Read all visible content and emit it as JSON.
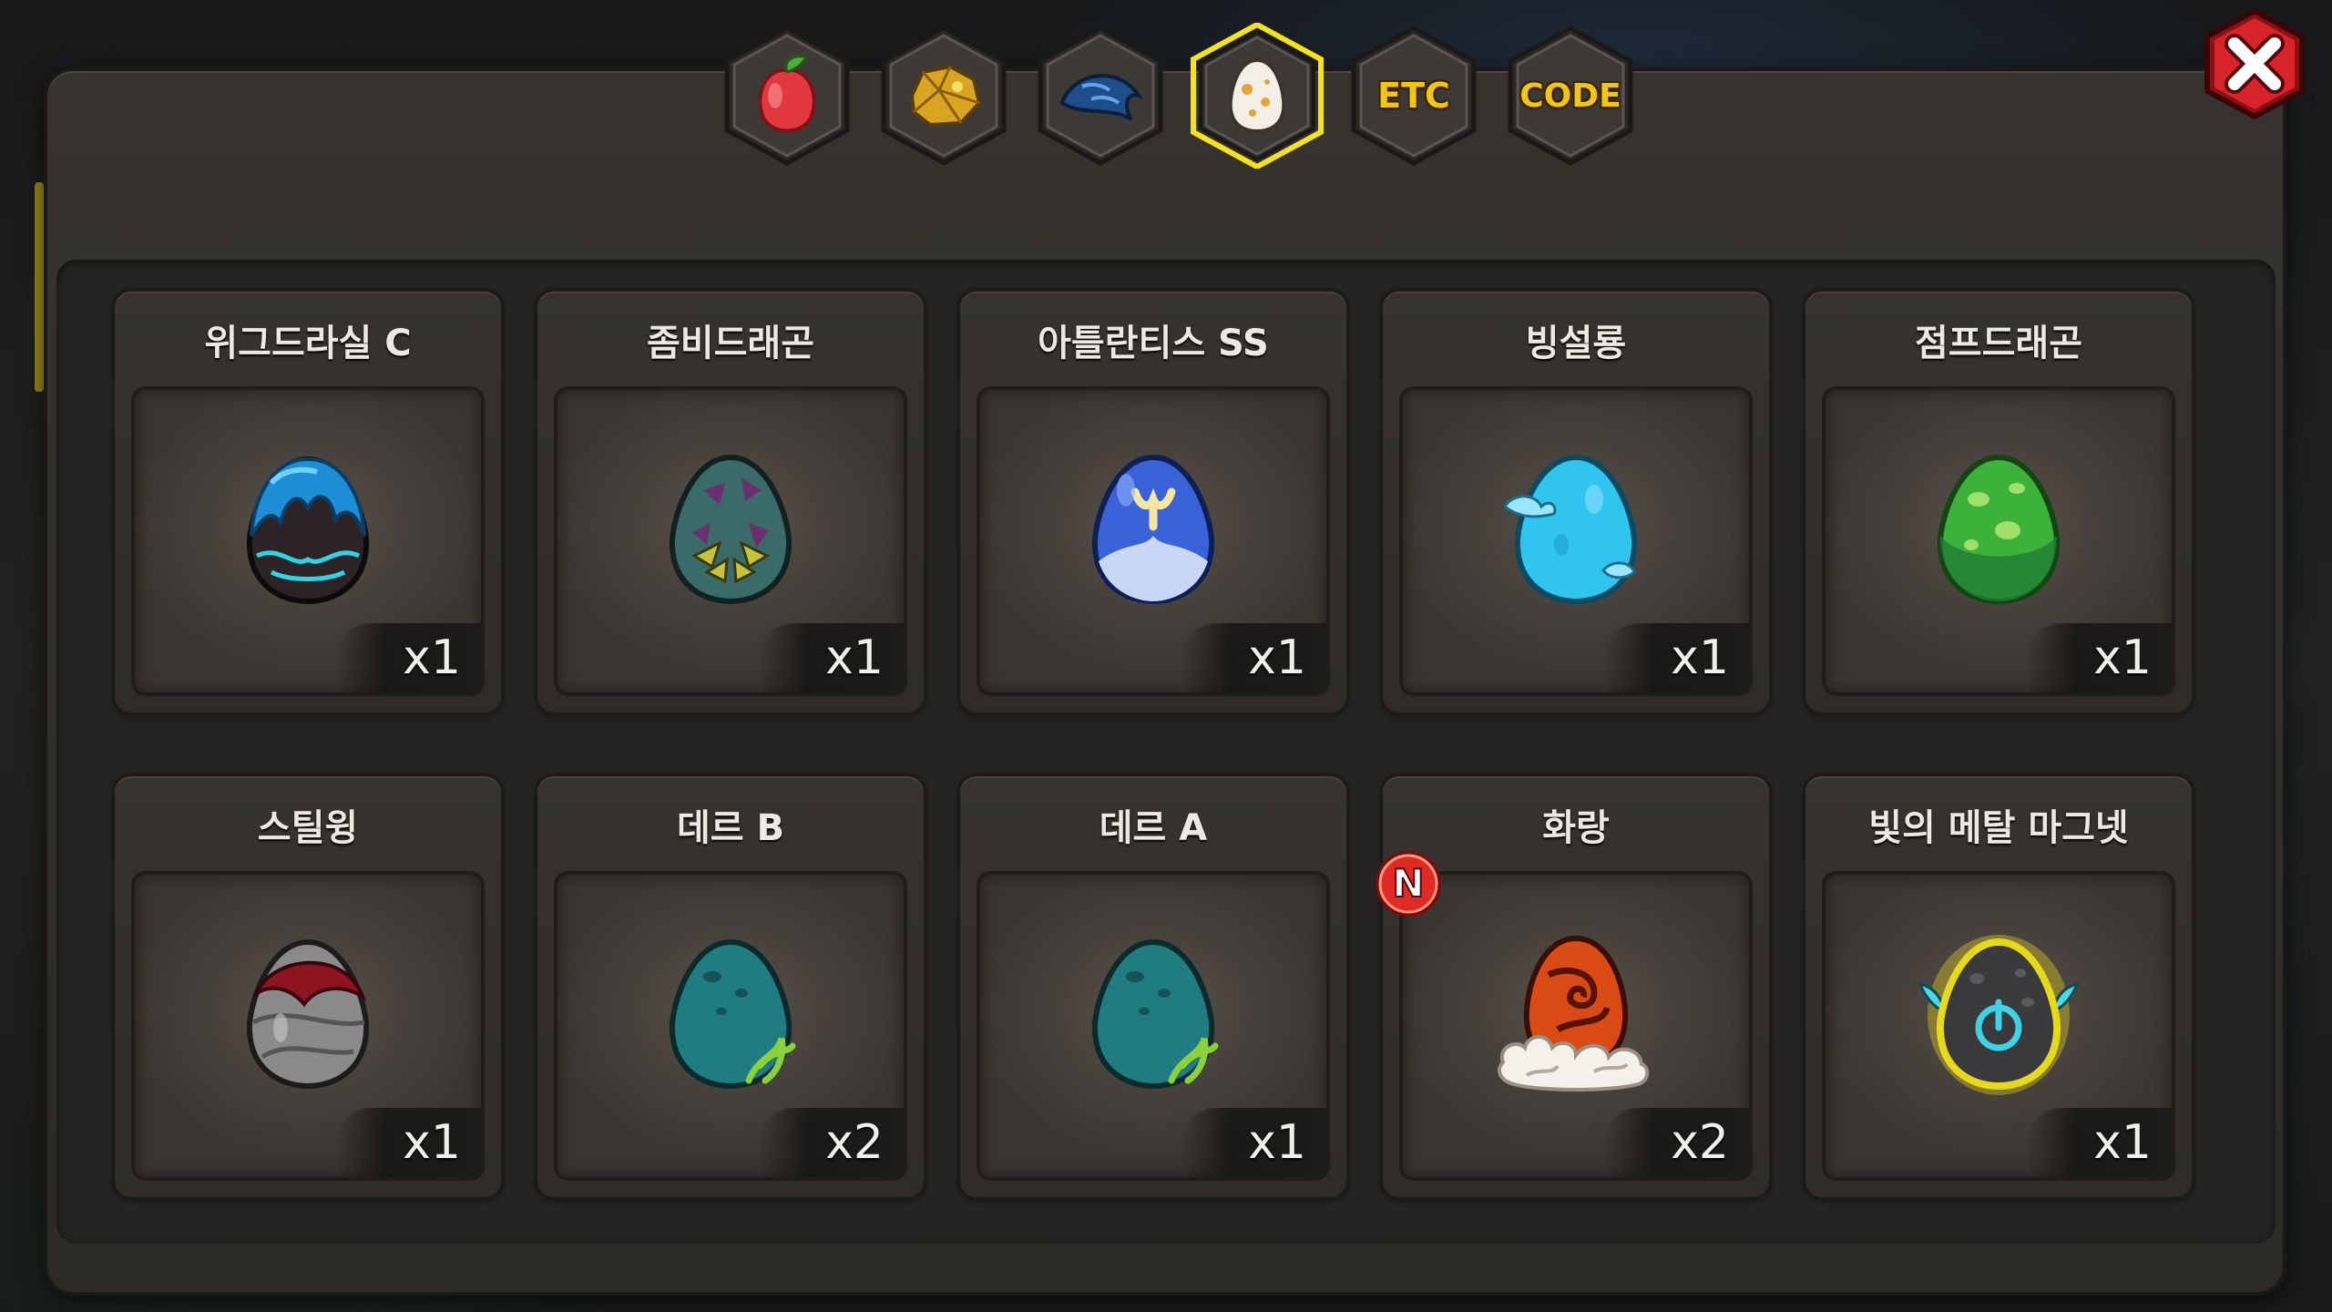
{
  "tabs": [
    {
      "id": "fruit",
      "icon": "fruit-icon",
      "active": false
    },
    {
      "id": "ore",
      "icon": "gold-ore-icon",
      "active": false
    },
    {
      "id": "scale",
      "icon": "dragon-scale-icon",
      "active": false
    },
    {
      "id": "egg",
      "icon": "egg-icon",
      "active": true
    },
    {
      "id": "etc",
      "label": "ETC",
      "active": false
    },
    {
      "id": "code",
      "label": "CODE",
      "active": false
    }
  ],
  "close_icon": "close-icon",
  "accent_color": "#f5e21a",
  "items": [
    {
      "name": "위그드라실 C",
      "qty": "x1",
      "egg": "yggdrasil-c-egg-icon",
      "new": false
    },
    {
      "name": "좀비드래곤",
      "qty": "x1",
      "egg": "zombie-dragon-egg-icon",
      "new": false
    },
    {
      "name": "아틀란티스 SS",
      "qty": "x1",
      "egg": "atlantis-ss-egg-icon",
      "new": false
    },
    {
      "name": "빙설룡",
      "qty": "x1",
      "egg": "ice-dragon-egg-icon",
      "new": false
    },
    {
      "name": "점프드래곤",
      "qty": "x1",
      "egg": "jump-dragon-egg-icon",
      "new": false
    },
    {
      "name": "스틸윙",
      "qty": "x1",
      "egg": "steelwing-egg-icon",
      "new": false
    },
    {
      "name": "데르 B",
      "qty": "x2",
      "egg": "der-b-egg-icon",
      "new": false
    },
    {
      "name": "데르 A",
      "qty": "x1",
      "egg": "der-a-egg-icon",
      "new": false
    },
    {
      "name": "화랑",
      "qty": "x2",
      "egg": "hwarang-egg-icon",
      "new": true,
      "new_label": "N"
    },
    {
      "name": "빛의 메탈 마그넷",
      "qty": "x1",
      "egg": "light-metal-magnet-icon",
      "new": false
    }
  ]
}
